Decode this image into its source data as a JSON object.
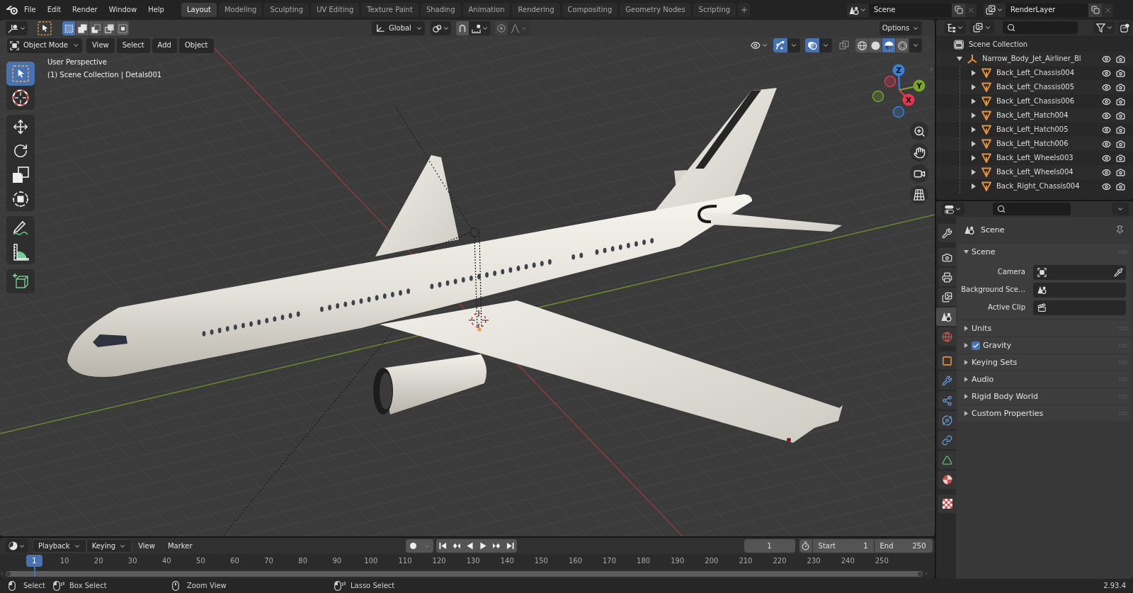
{
  "topbar": {
    "menus": [
      "File",
      "Edit",
      "Render",
      "Window",
      "Help"
    ],
    "workspaces": [
      {
        "label": "Layout",
        "selected": true
      },
      {
        "label": "Modeling",
        "selected": false
      },
      {
        "label": "Sculpting",
        "selected": false
      },
      {
        "label": "UV Editing",
        "selected": false
      },
      {
        "label": "Texture Paint",
        "selected": false
      },
      {
        "label": "Shading",
        "selected": false
      },
      {
        "label": "Animation",
        "selected": false
      },
      {
        "label": "Rendering",
        "selected": false
      },
      {
        "label": "Compositing",
        "selected": false
      },
      {
        "label": "Geometry Nodes",
        "selected": false
      },
      {
        "label": "Scripting",
        "selected": false
      }
    ],
    "scene": "Scene",
    "view_layer": "RenderLayer"
  },
  "viewport": {
    "tool_header": {
      "select_modes": [
        {
          "kind": "set",
          "selected": true
        },
        {
          "kind": "extend",
          "selected": false
        },
        {
          "kind": "subtract",
          "selected": false
        },
        {
          "kind": "invert",
          "selected": false
        },
        {
          "kind": "intersect",
          "selected": false
        }
      ],
      "orientation": "Global",
      "options": "Options"
    },
    "header": {
      "mode": "Object Mode",
      "menus": [
        "View",
        "Select",
        "Add",
        "Object"
      ],
      "toggles": [
        {
          "kind": "gizmos",
          "on": true
        },
        {
          "kind": "overlays",
          "on": true
        },
        {
          "kind": "xray",
          "on": false
        }
      ],
      "shading": [
        {
          "kind": "wireframe",
          "selected": false
        },
        {
          "kind": "solid",
          "selected": false
        },
        {
          "kind": "material",
          "selected": true
        },
        {
          "kind": "rendered",
          "selected": false
        }
      ]
    },
    "info": [
      "User Perspective",
      "(1) Scene Collection | Detals001"
    ],
    "tools": [
      [
        {
          "kind": "select_box",
          "selected": true
        },
        {
          "kind": "cursor",
          "selected": false
        }
      ],
      [
        {
          "kind": "move",
          "selected": false
        },
        {
          "kind": "rotate",
          "selected": false
        },
        {
          "kind": "scale",
          "selected": false
        },
        {
          "kind": "transform",
          "selected": false
        }
      ],
      [
        {
          "kind": "annotate",
          "selected": false
        },
        {
          "kind": "measure",
          "selected": false
        }
      ],
      [
        {
          "kind": "add_cube",
          "selected": false
        }
      ]
    ],
    "navigation_gizmo": [
      {
        "label": "Z",
        "color": "#3a7fd8"
      },
      {
        "label": "Y",
        "color": "#7aa52a"
      },
      {
        "label": "X",
        "color": "#e4364f"
      }
    ]
  },
  "outliner": {
    "tree": [
      {
        "name": "Scene Collection",
        "kind": "collection",
        "children": [
          {
            "name": "Narrow_Body_Jet_Airliner_Bl",
            "kind": "empty",
            "expanded": true,
            "children": [
              {
                "name": "Back_Left_Chassis004",
                "kind": "mesh",
                "expanded": false
              },
              {
                "name": "Back_Left_Chassis005",
                "kind": "mesh",
                "expanded": false
              },
              {
                "name": "Back_Left_Chassis006",
                "kind": "mesh",
                "expanded": false
              },
              {
                "name": "Back_Left_Hatch004",
                "kind": "mesh",
                "expanded": false
              },
              {
                "name": "Back_Left_Hatch005",
                "kind": "mesh",
                "expanded": false
              },
              {
                "name": "Back_Left_Hatch006",
                "kind": "mesh",
                "expanded": false
              },
              {
                "name": "Back_Left_Wheels003",
                "kind": "mesh",
                "expanded": false
              },
              {
                "name": "Back_Left_Wheels004",
                "kind": "mesh",
                "expanded": false
              },
              {
                "name": "Back_Right_Chassis004",
                "kind": "mesh",
                "expanded": false
              }
            ]
          }
        ]
      }
    ]
  },
  "properties": {
    "tabs": [
      [
        {
          "kind": "tool",
          "selected": false
        }
      ],
      [
        {
          "kind": "render",
          "selected": false
        },
        {
          "kind": "output",
          "selected": false
        },
        {
          "kind": "view_layer",
          "selected": false
        },
        {
          "kind": "scene",
          "selected": true
        },
        {
          "kind": "world",
          "selected": false
        }
      ],
      [
        {
          "kind": "object",
          "selected": false
        },
        {
          "kind": "modifiers",
          "selected": false
        },
        {
          "kind": "particles",
          "selected": false
        },
        {
          "kind": "physics",
          "selected": false
        },
        {
          "kind": "constraints",
          "selected": false
        },
        {
          "kind": "data",
          "selected": false
        },
        {
          "kind": "material",
          "selected": false
        }
      ],
      [
        {
          "kind": "texture",
          "selected": false
        }
      ]
    ],
    "context": "Scene",
    "panels": [
      {
        "title": "Scene",
        "expanded": true,
        "fields": [
          {
            "label": "Camera",
            "kind": "camera"
          },
          {
            "label": "Background Sce…",
            "kind": "scene"
          },
          {
            "label": "Active Clip",
            "kind": "clip"
          }
        ]
      },
      {
        "title": "Units",
        "expanded": false
      },
      {
        "title": "Gravity",
        "expanded": false,
        "checked": true
      },
      {
        "title": "Keying Sets",
        "expanded": false
      },
      {
        "title": "Audio",
        "expanded": false
      },
      {
        "title": "Rigid Body World",
        "expanded": false
      },
      {
        "title": "Custom Properties",
        "expanded": false
      }
    ]
  },
  "timeline": {
    "menus": [
      {
        "label": "Playback",
        "kind": "dropdown"
      },
      {
        "label": "Keying",
        "kind": "dropdown"
      },
      {
        "label": "View",
        "kind": "menu"
      },
      {
        "label": "Marker",
        "kind": "menu"
      }
    ],
    "current_frame": "1",
    "start": {
      "label": "Start",
      "value": "1"
    },
    "end": {
      "label": "End",
      "value": "250"
    },
    "playhead": "1",
    "ruler": [
      "10",
      "20",
      "30",
      "40",
      "50",
      "60",
      "70",
      "80",
      "90",
      "100",
      "110",
      "120",
      "130",
      "140",
      "150",
      "160",
      "170",
      "180",
      "190",
      "200",
      "210",
      "220",
      "230",
      "240",
      "250"
    ]
  },
  "status_bar": {
    "hints": [
      {
        "label": "Select",
        "kind": "click"
      },
      {
        "label": "Box Select",
        "kind": "drag"
      },
      {
        "label": "Zoom View",
        "kind": "middle"
      },
      {
        "label": "Lasso Select",
        "kind": "drag"
      }
    ],
    "version": "2.93.4"
  }
}
